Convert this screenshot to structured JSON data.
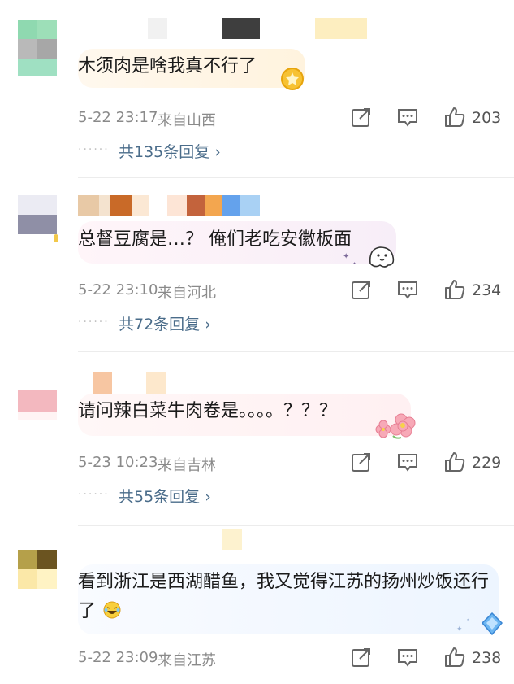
{
  "comments": [
    {
      "text": "木须肉是啥我真不行了",
      "time": "5-22 23:17",
      "location": "来自山西",
      "likes": "203",
      "replies": "共135条回复 ›",
      "dots": "······"
    },
    {
      "text": "总督豆腐是…？ 俺们老吃安徽板面",
      "time": "5-22 23:10",
      "location": "来自河北",
      "likes": "234",
      "replies": "共72条回复 ›",
      "dots": "······"
    },
    {
      "text": "请问辣白菜牛肉卷是。。。。？？？",
      "time": "5-23 10:23",
      "location": "来自吉林",
      "likes": "229",
      "replies": "共55条回复 ›",
      "dots": "······"
    },
    {
      "text": "看到浙江是西湖醋鱼，我又觉得江苏的扬州炒饭还行了",
      "time": "5-22 23:09",
      "location": "来自江苏",
      "likes": "238"
    }
  ],
  "icons": {
    "share": "share-icon",
    "comment": "comment-icon",
    "like": "thumbs-up-icon"
  },
  "colors": {
    "meta_gray": "#8a8a8a",
    "reply_link": "#4a6c8a",
    "divider": "#ececec"
  }
}
